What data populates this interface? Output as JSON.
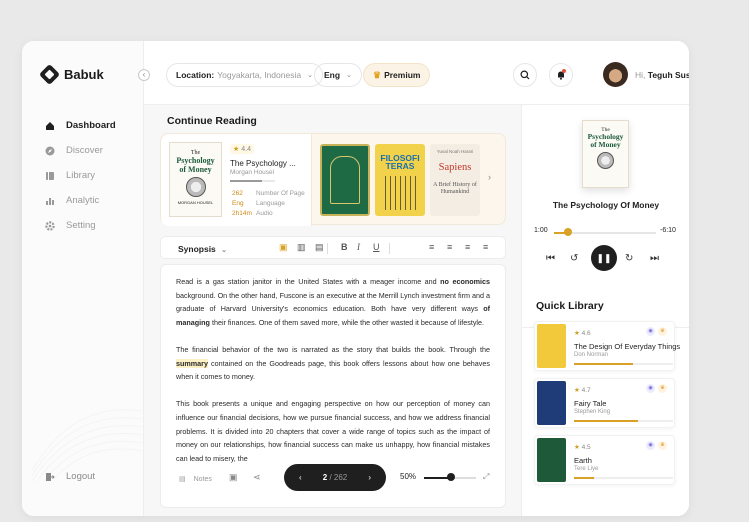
{
  "brand": {
    "name": "Babuk"
  },
  "sidebar": {
    "items": [
      {
        "label": "Dashboard",
        "icon": "home-icon",
        "active": true
      },
      {
        "label": "Discover",
        "icon": "compass-icon",
        "active": false
      },
      {
        "label": "Library",
        "icon": "library-icon",
        "active": false
      },
      {
        "label": "Analytic",
        "icon": "chart-icon",
        "active": false
      },
      {
        "label": "Setting",
        "icon": "gear-icon",
        "active": false
      }
    ],
    "logout": "Logout"
  },
  "header": {
    "location_label": "Location:",
    "location_value": "Yogyakarta, Indonesia",
    "language": "Eng",
    "premium": "Premium",
    "greeting_prefix": "Hi,",
    "user_name": "Teguh Susilo"
  },
  "continue_reading": {
    "title": "Continue Reading",
    "current": {
      "cover_small": "The",
      "cover_title": "Psychology of Money",
      "cover_author": "MORGAN HOUSEL",
      "rating": "4.4",
      "title": "The Psychology ...",
      "author": "Morgan Housel",
      "progress": 0.7,
      "stats": [
        {
          "value": "262",
          "key": "Number Of Page"
        },
        {
          "value": "Eng",
          "key": "Language"
        },
        {
          "value": "2h14m",
          "key": "Audio"
        }
      ]
    },
    "others": [
      {
        "title": "FILOSOFI TERAS"
      },
      {
        "author": "Yuval Noah Harari",
        "title": "Sapiens",
        "subtitle": "A Brief History of Humankind"
      }
    ]
  },
  "toolbar": {
    "synopsis": "Synopsis"
  },
  "synopsis": {
    "p1_a": "Read is a gas station janitor in the United States with a meager income and ",
    "p1_b": "no economics",
    "p1_c": " background. On the other hand, Fuscone is an executive at the Merrill Lynch investment firm and a graduate of Harvard University's economics education. Both have very different ways ",
    "p1_d": "of managing",
    "p1_e": " their finances. One of them saved more, while the other wasted it because of lifestyle.",
    "p2_a": "The financial behavior of the two is narrated as the story that builds the book. Through the ",
    "p2_b": "summary",
    "p2_c": " contained on the Goodreads page, this book offers lessons about how one behaves when it comes to money.",
    "p3": "This book presents a unique and engaging perspective on how our perception of money can influence our financial decisions, how we pursue financial success, and how we address financial problems. It is divided into 20 chapters that cover a wide range of topics such as the impact of money on our relationships, how financial success can make us unhappy, how financial mistakes can lead to misery, the"
  },
  "reader_footer": {
    "notes": "Notes",
    "page_current": "2",
    "page_total": "/ 262",
    "zoom": "50%",
    "zoom_level": 0.5
  },
  "player": {
    "cover_small": "The",
    "cover_title": "Psychology of Money",
    "title": "The Psychology Of Money",
    "time_elapsed": "1:00",
    "time_remaining": "-6:10",
    "progress": 0.14
  },
  "quick_library": {
    "title": "Quick Library",
    "items": [
      {
        "rating": "4.6",
        "title": "The Design Of Everyday Things",
        "author": "Don Norman",
        "progress": 0.6,
        "cover_color": "#f1c93a"
      },
      {
        "rating": "4.7",
        "title": "Fairy Tale",
        "author": "Stephen King",
        "progress": 0.65,
        "cover_color": "#1f3c78"
      },
      {
        "rating": "4.5",
        "title": "Earth",
        "author": "Tere Liye",
        "progress": 0.2,
        "cover_color": "#1e5a3a"
      }
    ]
  },
  "colors": {
    "accent": "#d9a227",
    "dark": "#1f1f1f",
    "premium_bg": "#fbf3e6"
  }
}
